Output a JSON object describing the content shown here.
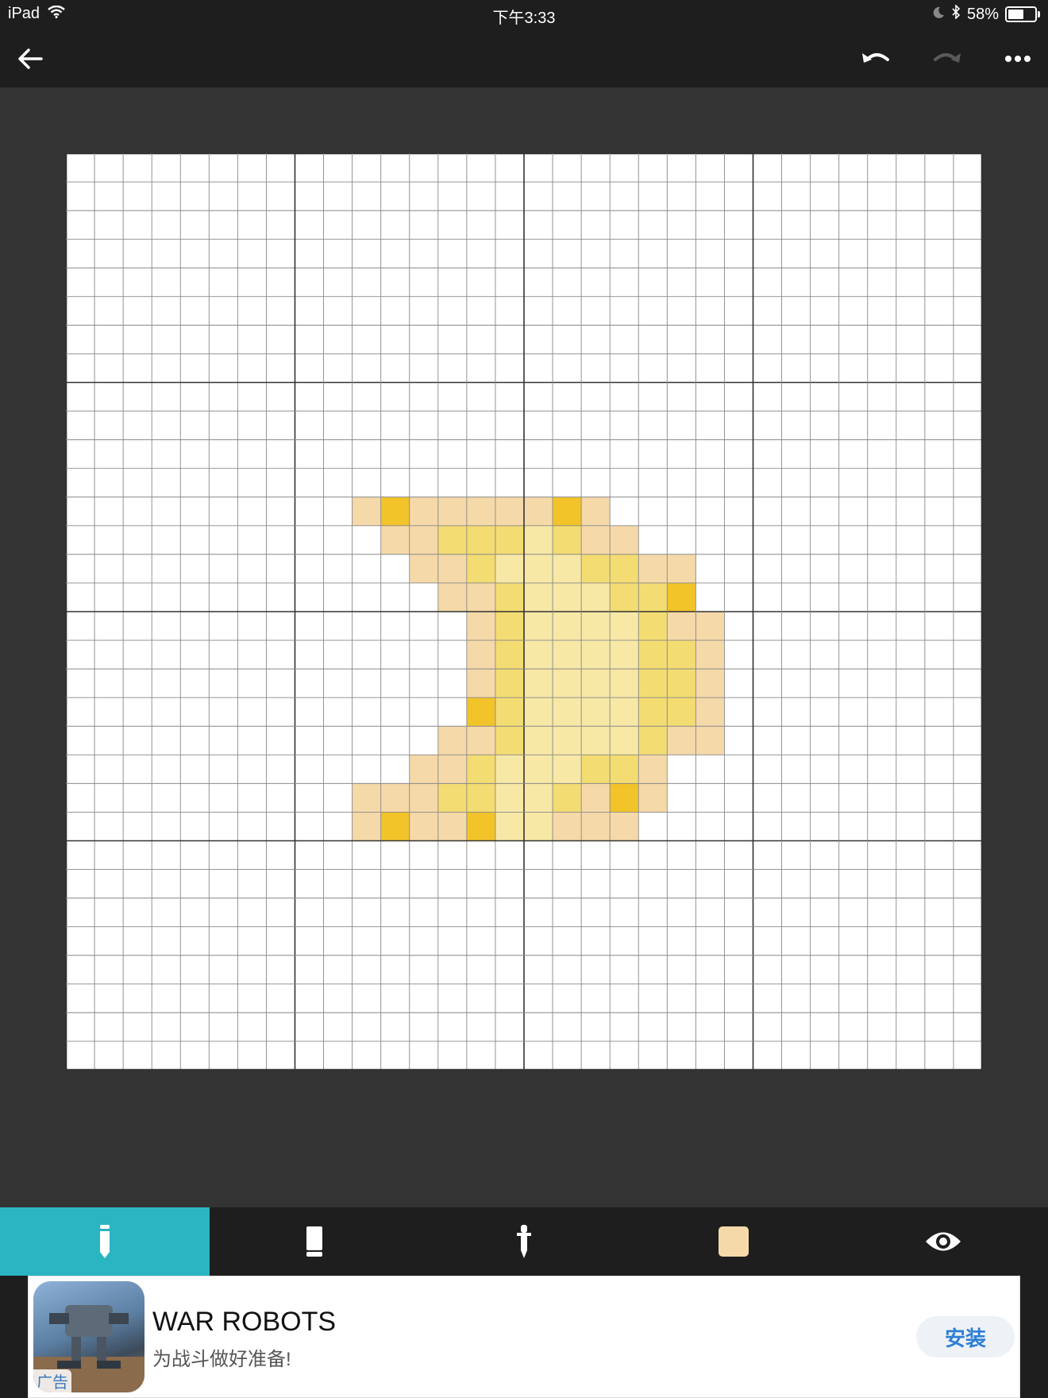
{
  "status_bar": {
    "device": "iPad",
    "time": "下午3:33",
    "battery_text": "58%",
    "battery_level": 0.58
  },
  "top_bar": {
    "back_icon": "arrow-left-icon",
    "undo_icon": "undo-icon",
    "redo_icon": "redo-icon",
    "more_icon": "more-dots-icon",
    "redo_enabled": false
  },
  "canvas": {
    "columns": 32,
    "rows": 32,
    "major_every": 8,
    "background": "#ffffff",
    "palette": {
      "A": "#f5d9a8",
      "B": "#f2c42a",
      "C": "#f3dc72",
      "D": "#f7e8a6"
    },
    "pixels": [
      {
        "row": 12,
        "cells": "AAAAAAAAA",
        "start": 10
      },
      {
        "row": 12,
        "cells": "B",
        "start": 11
      },
      {
        "row": 12,
        "cells": "B",
        "start": 17
      },
      {
        "row": 13,
        "cells": "AACCCDCAA",
        "start": 11
      },
      {
        "row": 14,
        "cells": "AACDDDCCAA",
        "start": 12
      },
      {
        "row": 15,
        "cells": "AACDDDCCB",
        "start": 13
      },
      {
        "row": 16,
        "cells": "ACDDDDCAA",
        "start": 14
      },
      {
        "row": 17,
        "cells": "ACDDDDCCA",
        "start": 14
      },
      {
        "row": 18,
        "cells": "ACDDDDCCA",
        "start": 14
      },
      {
        "row": 19,
        "cells": "BCDDDDCCA",
        "start": 14
      },
      {
        "row": 20,
        "cells": "AACDDDDCAA",
        "start": 13
      },
      {
        "row": 21,
        "cells": "AACDDDCCA",
        "start": 12
      },
      {
        "row": 22,
        "cells": "AAACCDDCABA",
        "start": 10
      },
      {
        "row": 23,
        "cells": "ABAABDDAAA",
        "start": 10
      }
    ]
  },
  "tools": [
    {
      "name": "pencil-tool",
      "icon": "pencil-icon",
      "active": true
    },
    {
      "name": "eraser-tool",
      "icon": "eraser-icon",
      "active": false
    },
    {
      "name": "eyedropper-tool",
      "icon": "eyedropper-icon",
      "active": false
    },
    {
      "name": "color-tool",
      "icon": "color-swatch-icon",
      "active": false,
      "color": "#f5d9a8"
    },
    {
      "name": "preview-tool",
      "icon": "eye-icon",
      "active": false
    }
  ],
  "ad": {
    "title": "WAR ROBOTS",
    "subtitle": "为战斗做好准备!",
    "install_label": "安装",
    "badge": "广告"
  }
}
